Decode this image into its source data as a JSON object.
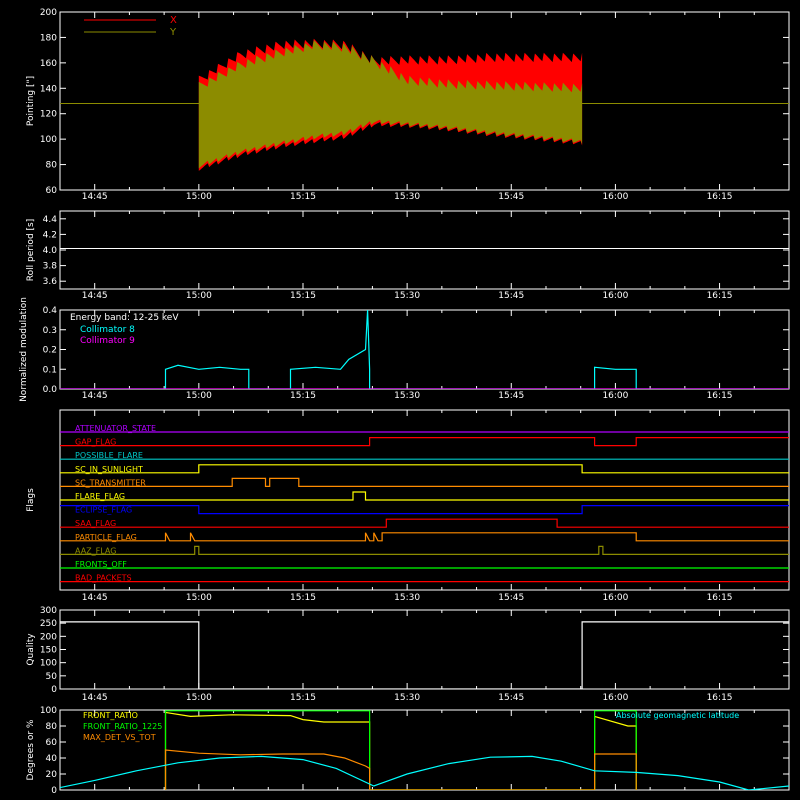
{
  "chart_data": [
    {
      "type": "line",
      "ylabel": "Pointing [\"]",
      "ylim": [
        60,
        200
      ],
      "yticks": [
        60,
        80,
        100,
        120,
        140,
        160,
        180,
        200
      ],
      "xlim": [
        14.6667,
        16.4167
      ],
      "xtick_values": [
        14.75,
        15.0,
        15.25,
        15.5,
        15.75,
        16.0,
        16.25
      ],
      "xtick_labels": [
        "14:45",
        "15:00",
        "15:15",
        "15:30",
        "15:45",
        "16:00",
        "16:15"
      ],
      "legend": [
        {
          "name": "X",
          "color": "#ff0000"
        },
        {
          "name": "Y",
          "color": "#8c8c00"
        }
      ],
      "series": [
        {
          "name": "X",
          "color": "#ff0000",
          "kind": "band",
          "x": [
            15.0,
            15.1,
            15.2,
            15.28,
            15.35,
            15.42,
            15.5,
            15.6,
            15.7,
            15.8,
            15.92
          ],
          "lower": [
            75,
            86,
            93,
            97,
            100,
            110,
            109,
            106,
            102,
            99,
            95
          ],
          "upper": [
            150,
            170,
            178,
            179,
            178,
            165,
            166,
            166,
            168,
            168,
            168
          ]
        },
        {
          "name": "Y",
          "color": "#8c8c00",
          "kind": "band",
          "x": [
            15.0,
            15.1,
            15.2,
            15.28,
            15.35,
            15.42,
            15.5,
            15.6,
            15.7,
            15.8,
            15.92
          ],
          "lower": [
            77,
            88,
            95,
            100,
            103,
            112,
            110,
            107,
            103,
            100,
            96
          ],
          "upper": [
            145,
            162,
            172,
            178,
            176,
            165,
            150,
            147,
            146,
            145,
            144
          ]
        },
        {
          "name": "mean",
          "color": "#8c8c00",
          "kind": "hline",
          "y": 128
        }
      ]
    },
    {
      "type": "line",
      "ylabel": "Roll period [s]",
      "ylim": [
        3.5,
        4.5
      ],
      "yticks": [
        3.6,
        3.8,
        4.0,
        4.2,
        4.4
      ],
      "ytick_labels": [
        "3.6",
        "3.8",
        "4.0",
        "4.2",
        "4.4"
      ],
      "xlim": [
        14.6667,
        16.4167
      ],
      "xtick_values": [
        14.75,
        15.0,
        15.25,
        15.5,
        15.75,
        16.0,
        16.25
      ],
      "xtick_labels": [
        "14:45",
        "15:00",
        "15:15",
        "15:30",
        "15:45",
        "16:00",
        "16:15"
      ],
      "series": [
        {
          "name": "",
          "color": "#ffffff",
          "kind": "hline",
          "y": 4.02
        }
      ]
    },
    {
      "type": "line",
      "ylabel": "Normalized modulation",
      "ylim": [
        0,
        0.4
      ],
      "yticks": [
        0,
        0.1,
        0.2,
        0.3,
        0.4
      ],
      "ytick_labels": [
        "0.0",
        "0.1",
        "0.2",
        "0.3",
        "0.4"
      ],
      "xlim": [
        14.6667,
        16.4167
      ],
      "xtick_values": [
        14.75,
        15.0,
        15.25,
        15.5,
        15.75,
        16.0,
        16.25
      ],
      "xtick_labels": [
        "14:45",
        "15:00",
        "15:15",
        "15:30",
        "15:45",
        "16:00",
        "16:15"
      ],
      "annotation": "Energy band: 12-25 keV",
      "legend": [
        {
          "name": "Collimator 8",
          "color": "#00ffff"
        },
        {
          "name": "Collimator 9",
          "color": "#ff00ff"
        }
      ],
      "series": [
        {
          "name": "Collimator 8",
          "color": "#00ffff",
          "kind": "line",
          "x": [
            14.6667,
            14.92,
            14.92,
            14.95,
            15.0,
            15.05,
            15.1,
            15.12,
            15.12,
            15.22,
            15.22,
            15.28,
            15.34,
            15.36,
            15.4,
            15.405,
            15.41,
            15.41,
            15.95,
            15.95,
            16.0,
            16.05,
            16.05,
            16.4167
          ],
          "y": [
            0,
            0,
            0.1,
            0.12,
            0.1,
            0.11,
            0.1,
            0.1,
            0,
            0,
            0.1,
            0.11,
            0.1,
            0.15,
            0.2,
            0.4,
            0.1,
            0,
            0,
            0.11,
            0.1,
            0.1,
            0,
            0
          ]
        },
        {
          "name": "Collimator 9",
          "color": "#ff00ff",
          "kind": "line",
          "x": [
            14.6667,
            16.4167
          ],
          "y": [
            0,
            0
          ]
        }
      ]
    },
    {
      "type": "line",
      "ylabel": "Flags",
      "xlim": [
        14.6667,
        16.4167
      ],
      "xtick_values": [
        14.75,
        15.0,
        15.25,
        15.5,
        15.75,
        16.0,
        16.25
      ],
      "xtick_labels": [
        "14:45",
        "15:00",
        "15:15",
        "15:30",
        "15:45",
        "16:00",
        "16:15"
      ],
      "series": [
        {
          "name": "ATTENUATOR_STATE",
          "color": "#b000ff",
          "kind": "flag",
          "x": [
            14.6667,
            16.4167
          ],
          "y": [
            0,
            0
          ]
        },
        {
          "name": "GAP_FLAG",
          "color": "#ff0000",
          "kind": "flag",
          "x": [
            14.6667,
            15.41,
            15.41,
            15.95,
            15.95,
            16.05,
            16.05,
            16.4167
          ],
          "y": [
            0,
            0,
            1,
            1,
            0,
            0,
            1,
            1
          ]
        },
        {
          "name": "POSSIBLE_FLARE",
          "color": "#00c8c8",
          "kind": "flag",
          "x": [
            14.6667,
            16.4167
          ],
          "y": [
            0,
            0
          ]
        },
        {
          "name": "SC_IN_SUNLIGHT",
          "color": "#ffff00",
          "kind": "flag",
          "x": [
            14.6667,
            15.0,
            15.0,
            15.92,
            15.92,
            16.4167
          ],
          "y": [
            0,
            0,
            1,
            1,
            0,
            0
          ]
        },
        {
          "name": "SC_TRANSMITTER",
          "color": "#ff8c00",
          "kind": "flag",
          "x": [
            14.6667,
            15.08,
            15.08,
            15.16,
            15.16,
            15.17,
            15.17,
            15.24,
            15.24,
            16.4167
          ],
          "y": [
            0,
            0,
            1,
            1,
            0,
            0,
            1,
            1,
            0,
            0
          ]
        },
        {
          "name": "FLARE_FLAG",
          "color": "#ffff00",
          "kind": "flag",
          "x": [
            14.6667,
            15.37,
            15.37,
            15.4,
            15.4,
            16.4167
          ],
          "y": [
            0,
            0,
            1,
            1,
            0,
            0
          ]
        },
        {
          "name": "ECLIPSE_FLAG",
          "color": "#0000ff",
          "kind": "flag",
          "x": [
            14.6667,
            15.0,
            15.0,
            15.92,
            15.92,
            16.4167
          ],
          "y": [
            1,
            1,
            0,
            0,
            1,
            1
          ]
        },
        {
          "name": "SAA_FLAG",
          "color": "#ff0000",
          "kind": "flag",
          "x": [
            14.6667,
            15.45,
            15.45,
            15.86,
            15.86,
            16.4167
          ],
          "y": [
            0,
            0,
            1,
            1,
            0,
            0
          ]
        },
        {
          "name": "PARTICLE_FLAG",
          "color": "#ff8c00",
          "kind": "flag",
          "x": [
            14.6667,
            14.92,
            14.92,
            14.93,
            14.93,
            14.98,
            14.98,
            14.99,
            14.99,
            15.4,
            15.4,
            15.41,
            15.41,
            15.42,
            15.42,
            15.43,
            15.43,
            15.44,
            15.44,
            15.45,
            15.45,
            16.05,
            16.05,
            16.4167
          ],
          "y": [
            0,
            0,
            1,
            0,
            0,
            0,
            1,
            0,
            0,
            0,
            1,
            0,
            0,
            0,
            1,
            0,
            0,
            0,
            1,
            1,
            1,
            1,
            0,
            0
          ]
        },
        {
          "name": "AAZ_FLAG",
          "color": "#8c8c00",
          "kind": "flag",
          "x": [
            14.6667,
            14.99,
            14.99,
            15.0,
            15.0,
            15.96,
            15.96,
            15.97,
            15.97,
            16.4167
          ],
          "y": [
            0,
            0,
            1,
            1,
            0,
            0,
            1,
            1,
            0,
            0
          ]
        },
        {
          "name": "FRONTS_OFF",
          "color": "#00ff00",
          "kind": "flag",
          "x": [
            14.6667,
            16.4167
          ],
          "y": [
            0,
            0
          ]
        },
        {
          "name": "BAD_PACKETS",
          "color": "#ff0000",
          "kind": "flag",
          "x": [
            14.6667,
            16.4167
          ],
          "y": [
            0,
            0
          ]
        }
      ]
    },
    {
      "type": "line",
      "ylabel": "Quality",
      "ylim": [
        0,
        300
      ],
      "yticks": [
        0,
        50,
        100,
        150,
        200,
        250,
        300
      ],
      "xlim": [
        14.6667,
        16.4167
      ],
      "xtick_values": [
        14.75,
        15.0,
        15.25,
        15.5,
        15.75,
        16.0,
        16.25
      ],
      "xtick_labels": [
        "14:45",
        "15:00",
        "15:15",
        "15:30",
        "15:45",
        "16:00",
        "16:15"
      ],
      "series": [
        {
          "name": "",
          "color": "#ffffff",
          "kind": "line",
          "x": [
            14.6667,
            15.0,
            15.0,
            15.92,
            15.92,
            16.4167
          ],
          "y": [
            255,
            255,
            0,
            0,
            255,
            255
          ]
        }
      ]
    },
    {
      "type": "line",
      "ylabel": "Degrees or %",
      "ylim": [
        0,
        100
      ],
      "yticks": [
        0,
        20,
        40,
        60,
        80,
        100
      ],
      "xlim": [
        14.6667,
        16.4167
      ],
      "xtick_values": [
        14.75,
        15.0,
        15.25,
        15.5,
        15.75,
        16.0,
        16.25
      ],
      "xtick_labels": [
        "14:45",
        "15:00",
        "15:15",
        "15:30",
        "15:45",
        "16:00",
        "16:15"
      ],
      "legend": [
        {
          "name": "FRONT_RATIO",
          "color": "#ffff00"
        },
        {
          "name": "FRONT_RATIO_1225",
          "color": "#00ff00"
        },
        {
          "name": "MAX_DET_VS_TOT",
          "color": "#ff8c00"
        },
        {
          "name": "Absolute geomagnetic latitude",
          "color": "#00ffff"
        }
      ],
      "series": [
        {
          "name": "FRONT_RATIO",
          "color": "#ffff00",
          "kind": "line",
          "x": [
            14.92,
            14.92,
            14.98,
            15.08,
            15.22,
            15.25,
            15.3,
            15.41,
            15.41,
            15.95,
            15.95,
            16.03,
            16.05,
            16.05
          ],
          "y": [
            0,
            97,
            92,
            94,
            93,
            88,
            85,
            85,
            0,
            0,
            92,
            80,
            80,
            0
          ]
        },
        {
          "name": "FRONT_RATIO_1225",
          "color": "#00ff00",
          "kind": "line",
          "x": [
            14.92,
            14.92,
            15.0,
            15.2,
            15.4,
            15.41,
            15.41,
            15.95,
            15.95,
            16.05,
            16.05
          ],
          "y": [
            0,
            99,
            99,
            99,
            99,
            99,
            0,
            0,
            99,
            99,
            0
          ]
        },
        {
          "name": "MAX_DET_VS_TOT",
          "color": "#ff8c00",
          "kind": "line",
          "x": [
            14.92,
            14.92,
            15.0,
            15.1,
            15.2,
            15.3,
            15.35,
            15.4,
            15.41,
            15.41,
            15.95,
            15.95,
            16.0,
            16.05,
            16.05
          ],
          "y": [
            0,
            50,
            46,
            44,
            45,
            45,
            40,
            30,
            27,
            0,
            0,
            45,
            45,
            45,
            0
          ]
        },
        {
          "name": "Absolute geomagnetic latitude",
          "color": "#00ffff",
          "kind": "line",
          "x": [
            14.6667,
            14.75,
            14.85,
            14.95,
            15.05,
            15.15,
            15.25,
            15.33,
            15.42,
            15.5,
            15.6,
            15.7,
            15.8,
            15.87,
            15.95,
            16.05,
            16.15,
            16.25,
            16.32,
            16.4167
          ],
          "y": [
            3,
            12,
            24,
            34,
            40,
            42,
            38,
            27,
            5,
            20,
            33,
            41,
            42,
            36,
            24,
            22,
            18,
            10,
            0,
            5
          ]
        }
      ]
    }
  ]
}
